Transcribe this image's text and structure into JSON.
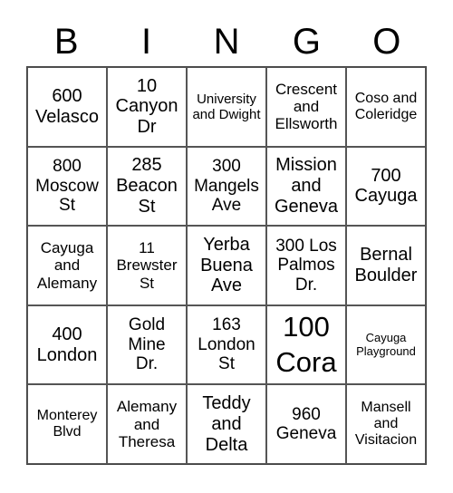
{
  "header": {
    "letters": [
      "B",
      "I",
      "N",
      "G",
      "O"
    ]
  },
  "cells": [
    [
      "600 Velasco",
      "10 Canyon Dr",
      "University and Dwight",
      "Crescent and Ellsworth",
      "Coso and Coleridge"
    ],
    [
      "800 Moscow St",
      "285 Beacon St",
      "300 Mangels Ave",
      "Mission and Geneva",
      "700 Cayuga"
    ],
    [
      "Cayuga and Alemany",
      "11 Brewster St",
      "Yerba Buena Ave",
      "300 Los Palmos Dr.",
      "Bernal Boulder"
    ],
    [
      "400 London",
      "Gold Mine Dr.",
      "163 London St",
      "100 Cora",
      "Cayuga Playground"
    ],
    [
      "Monterey Blvd",
      "Alemany and Theresa",
      "Teddy and Delta",
      "960 Geneva",
      "Mansell and Visitacion"
    ]
  ]
}
